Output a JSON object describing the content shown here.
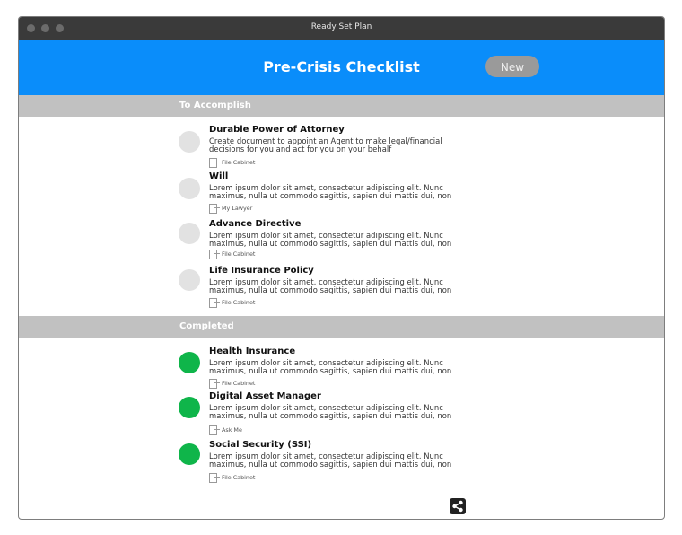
{
  "window": {
    "title": "Ready Set Plan"
  },
  "header": {
    "title": "Pre-Crisis Checklist",
    "new_button": "New"
  },
  "sections": [
    {
      "label": "To Accomplish",
      "items": [
        {
          "title": "Durable Power of Attorney",
          "desc": "Create document to appoint an Agent to make legal/financial decisions for you and act for you on your behalf",
          "link": "File Cabinet"
        },
        {
          "title": "Will",
          "desc": "Lorem ipsum dolor sit amet, consectetur adipiscing elit. Nunc maximus, nulla ut commodo sagittis, sapien dui mattis dui, non",
          "link": "My Lawyer"
        },
        {
          "title": "Advance Directive",
          "desc": "Lorem ipsum dolor sit amet, consectetur adipiscing elit. Nunc maximus, nulla ut commodo sagittis, sapien dui mattis dui, non",
          "link": "File Cabinet"
        },
        {
          "title": "Life Insurance Policy",
          "desc": "Lorem ipsum dolor sit amet, consectetur adipiscing elit. Nunc maximus, nulla ut commodo sagittis, sapien dui mattis dui, non",
          "link": "File Cabinet"
        }
      ]
    },
    {
      "label": "Completed",
      "items": [
        {
          "title": "Health Insurance",
          "desc": "Lorem ipsum dolor sit amet, consectetur adipiscing elit. Nunc maximus, nulla ut commodo sagittis, sapien dui mattis dui, non",
          "link": "File Cabinet"
        },
        {
          "title": "Digital Asset Manager",
          "desc": "Lorem ipsum dolor sit amet, consectetur adipiscing elit. Nunc maximus, nulla ut commodo sagittis, sapien dui mattis dui, non",
          "link": "Ask Me"
        },
        {
          "title": "Social Security (SSI)",
          "desc": "Lorem ipsum dolor sit amet, consectetur adipiscing elit. Nunc maximus, nulla ut commodo sagittis, sapien dui mattis dui, non",
          "link": "File Cabinet"
        }
      ]
    }
  ],
  "colors": {
    "header_bg": "#0a8dfa",
    "complete": "#0fb54a",
    "incomplete": "#e2e2e2",
    "section_bg": "#c1c1c1"
  },
  "icons": {
    "share": "share-icon",
    "link": "link-out-icon"
  }
}
